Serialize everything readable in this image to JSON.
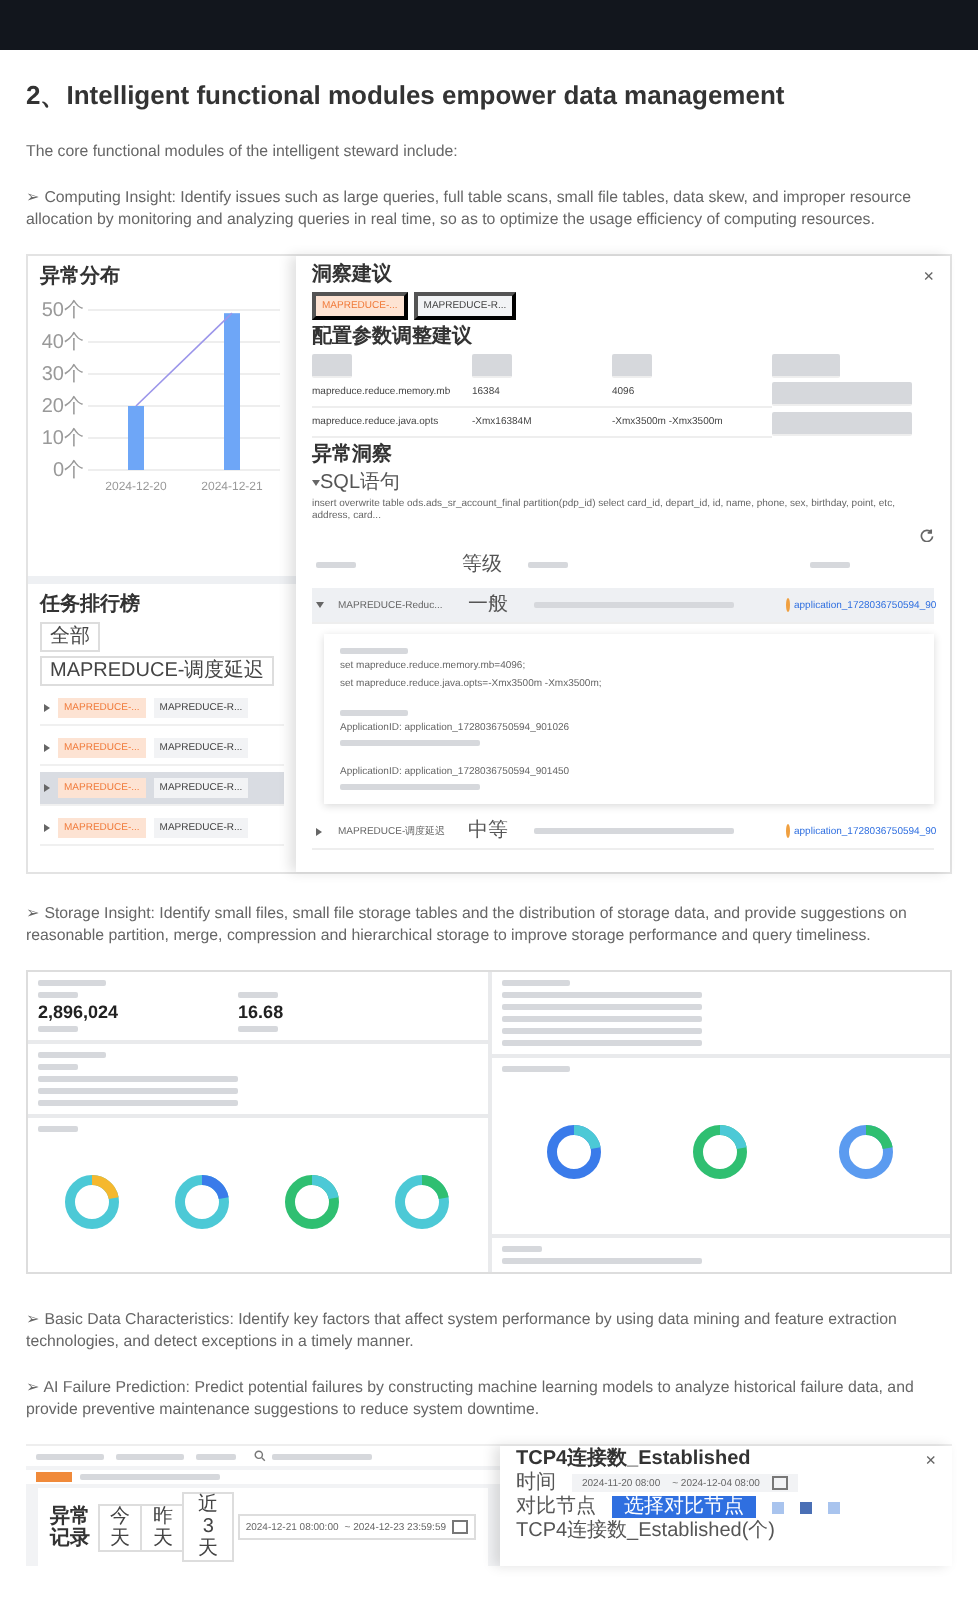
{
  "blocks": [
    {
      "kind": "heading",
      "text": "2、Intelligent functional modules empower data management"
    },
    {
      "kind": "paragraph",
      "text": "The core functional modules of the intelligent steward include:"
    },
    {
      "kind": "paragraph",
      "text": "➢ Computing Insight: Identify issues such as large queries, full table scans, small file tables, data skew, and improper resource allocation by monitoring and analyzing queries in real time, so as to optimize the usage efficiency of computing resources."
    },
    {
      "kind": "compute_screenshot",
      "chart_panel": {
        "title": "异常分布",
        "chart_data": {
          "type": "bar",
          "categories": [
            "2024-12-20",
            "2024-12-21"
          ],
          "values": [
            20,
            49
          ],
          "ylim": [
            0,
            50
          ],
          "grid": true,
          "yticks": [
            {
              "value": 0,
              "label": "0个"
            },
            {
              "value": 10,
              "label": "10个"
            },
            {
              "value": 20,
              "label": "20个"
            },
            {
              "value": 30,
              "label": "30个"
            },
            {
              "value": 40,
              "label": "40个"
            },
            {
              "value": 50,
              "label": "50个"
            }
          ]
        }
      },
      "ranking": {
        "title": "任务排行榜",
        "filters": [
          "全部",
          "MAPREDUCE-调度延迟"
        ],
        "rows": [
          {
            "tags": [
              "MAPREDUCE-...",
              "MAPREDUCE-R..."
            ],
            "selected": false
          },
          {
            "tags": [
              "MAPREDUCE-...",
              "MAPREDUCE-R..."
            ],
            "selected": false
          },
          {
            "tags": [
              "MAPREDUCE-...",
              "MAPREDUCE-R..."
            ],
            "selected": true
          },
          {
            "tags": [
              "MAPREDUCE-...",
              "MAPREDUCE-R..."
            ],
            "selected": false
          }
        ]
      },
      "drawer": {
        "title": "洞察建议",
        "close": "×",
        "tags": [
          {
            "label": "MAPREDUCE-...",
            "selected": true
          },
          {
            "label": "MAPREDUCE-R...",
            "selected": false
          }
        ],
        "config_title": "配置参数调整建议",
        "params": [
          [
            "mapreduce.reduce.memory.mb",
            "16384",
            "4096"
          ],
          [
            "mapreduce.reduce.java.opts",
            "-Xmx16384M",
            "-Xmx3500m -Xmx3500m"
          ]
        ],
        "insight_title": "异常洞察",
        "sql_label": "SQL语句",
        "sql": "insert overwrite table ods.ads_sr_account_final partition(pdp_id) select card_id, depart_id, id, name, phone, sex, birthday, point, etc, address, card...",
        "level_header": "等级",
        "insights": [
          {
            "name": "MAPREDUCE-Reduc...",
            "level": "一般",
            "expanded": true,
            "link": "application_1728036750594_90",
            "details": [
              "set mapreduce.reduce.memory.mb=4096;",
              "set mapreduce.reduce.java.opts=-Xmx3500m -Xmx3500m;",
              "ApplicationID: application_1728036750594_901026",
              "ApplicationID: application_1728036750594_901450"
            ]
          },
          {
            "name": "MAPREDUCE-调度延迟",
            "level": "中等",
            "expanded": false,
            "link": "application_1728036750594_90"
          }
        ]
      }
    },
    {
      "kind": "paragraph",
      "text": "➢ Storage Insight: Identify small files, small file storage tables and the distribution of storage data, and provide suggestions on reasonable partition, merge, compression and hierarchical storage to improve storage performance and query timeliness."
    },
    {
      "kind": "storage_screenshot",
      "totals": [
        "2,896,024",
        "16.68"
      ]
    },
    {
      "kind": "paragraph",
      "text": "➢ Basic Data Characteristics: Identify key factors that affect system performance by using data mining and feature extraction technologies, and detect exceptions in a timely manner."
    },
    {
      "kind": "paragraph",
      "text": "➢ AI Failure Prediction: Predict potential failures by constructing machine learning models to analyze historical failure data, and provide preventive maintenance suggestions to reduce system downtime."
    },
    {
      "kind": "failure_screenshot",
      "record_title": "异常记录",
      "ranges": [
        "今天",
        "昨天",
        "近3天"
      ],
      "date_from": "2024-12-21 08:00:00",
      "date_to": "~ 2024-12-23 23:59:59",
      "drawer": {
        "title": "TCP4连接数_Established",
        "close": "×",
        "time_label": "时间",
        "time_from": "2024-11-20 08:00",
        "time_to": "~ 2024-12-04 08:00",
        "node_label": "对比节点",
        "node_button": "选择对比节点",
        "chart_title": "TCP4连接数_Established(个)"
      }
    }
  ]
}
